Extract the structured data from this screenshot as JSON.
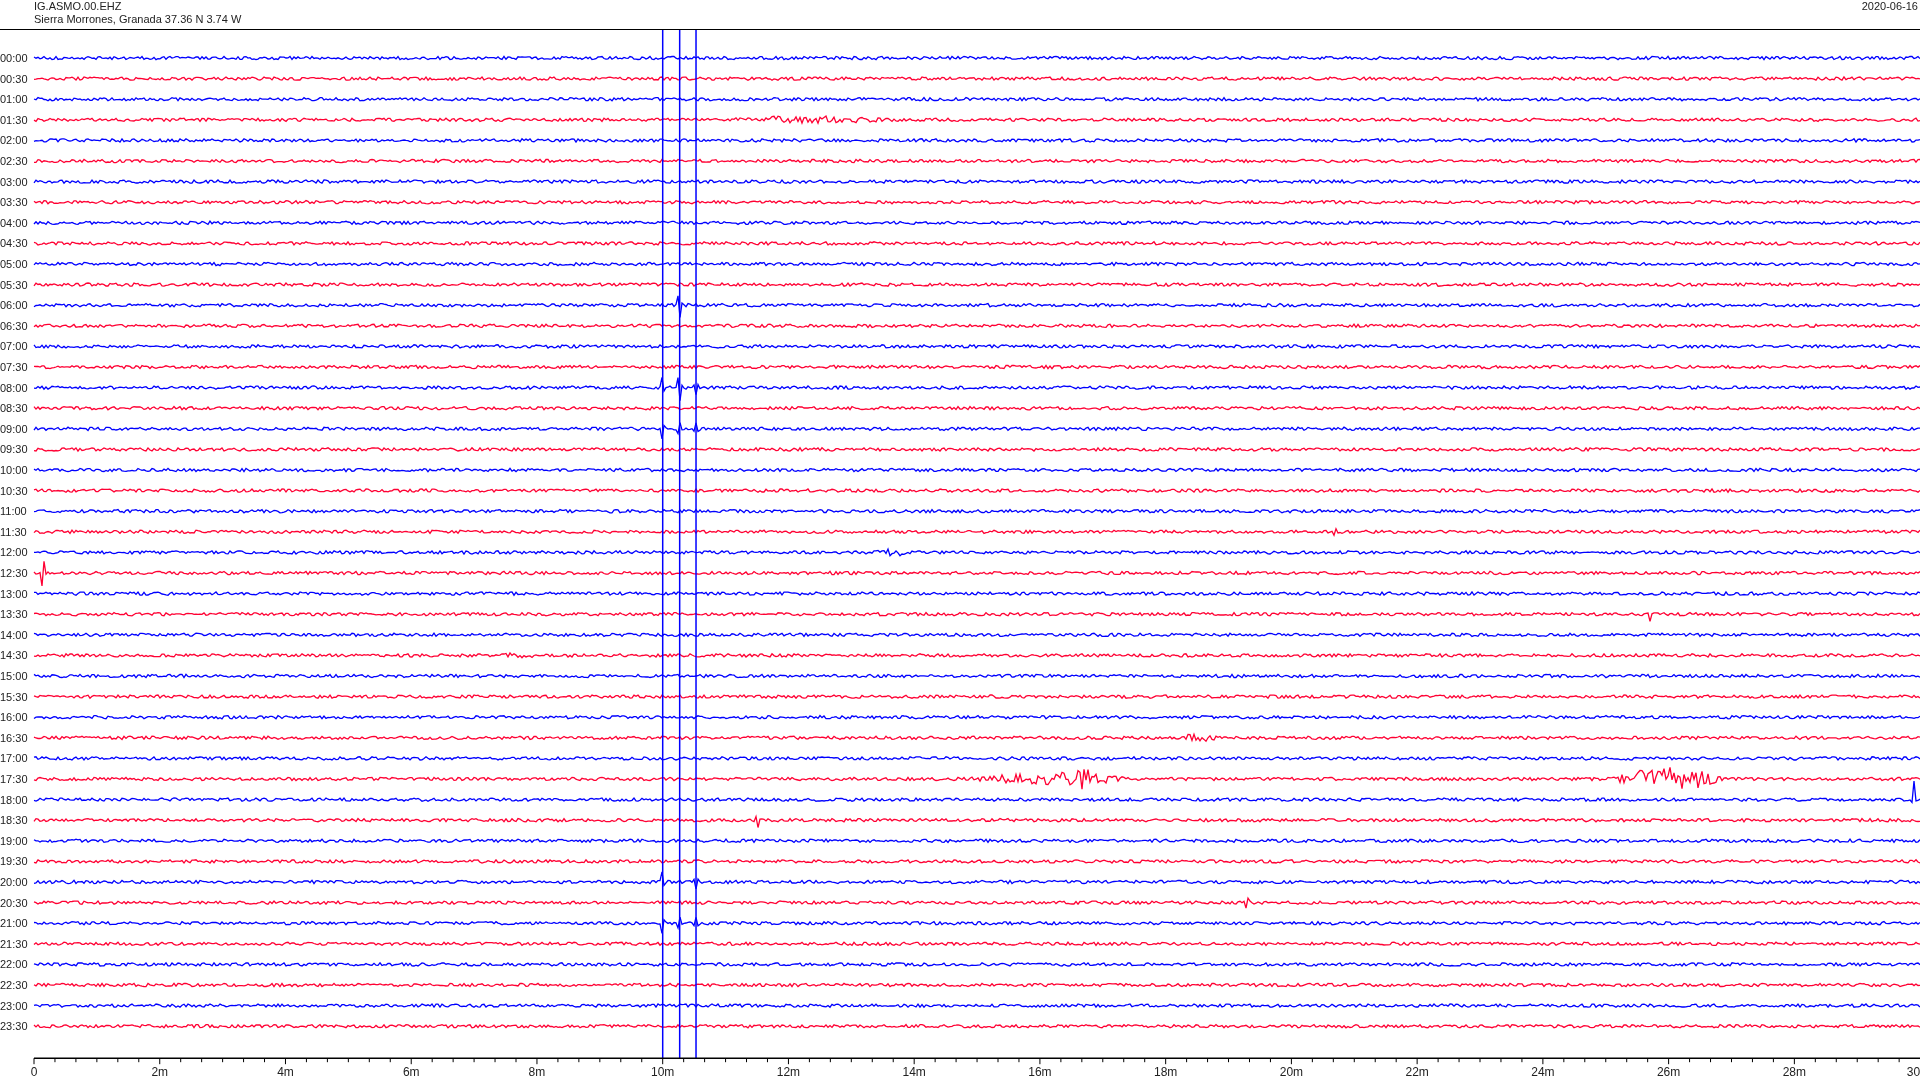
{
  "header": {
    "station": "IG.ASMO.00.EHZ",
    "location": "Sierra Morrones, Granada  37.36 N 3.74 W",
    "date": "2020-06-16"
  },
  "rows": [
    {
      "label": "00:00",
      "color": "#0000ff"
    },
    {
      "label": "00:30",
      "color": "#ff0033"
    },
    {
      "label": "01:00",
      "color": "#0000ff"
    },
    {
      "label": "01:30",
      "color": "#ff0033"
    },
    {
      "label": "02:00",
      "color": "#0000ff"
    },
    {
      "label": "02:30",
      "color": "#ff0033"
    },
    {
      "label": "03:00",
      "color": "#0000ff"
    },
    {
      "label": "03:30",
      "color": "#ff0033"
    },
    {
      "label": "04:00",
      "color": "#0000ff"
    },
    {
      "label": "04:30",
      "color": "#ff0033"
    },
    {
      "label": "05:00",
      "color": "#0000ff"
    },
    {
      "label": "05:30",
      "color": "#ff0033"
    },
    {
      "label": "06:00",
      "color": "#0000ff"
    },
    {
      "label": "06:30",
      "color": "#ff0033"
    },
    {
      "label": "07:00",
      "color": "#0000ff"
    },
    {
      "label": "07:30",
      "color": "#ff0033"
    },
    {
      "label": "08:00",
      "color": "#0000ff"
    },
    {
      "label": "08:30",
      "color": "#ff0033"
    },
    {
      "label": "09:00",
      "color": "#0000ff"
    },
    {
      "label": "09:30",
      "color": "#ff0033"
    },
    {
      "label": "10:00",
      "color": "#0000ff"
    },
    {
      "label": "10:30",
      "color": "#ff0033"
    },
    {
      "label": "11:00",
      "color": "#0000ff"
    },
    {
      "label": "11:30",
      "color": "#ff0033"
    },
    {
      "label": "12:00",
      "color": "#0000ff"
    },
    {
      "label": "12:30",
      "color": "#ff0033"
    },
    {
      "label": "13:00",
      "color": "#0000ff"
    },
    {
      "label": "13:30",
      "color": "#ff0033"
    },
    {
      "label": "14:00",
      "color": "#0000ff"
    },
    {
      "label": "14:30",
      "color": "#ff0033"
    },
    {
      "label": "15:00",
      "color": "#0000ff"
    },
    {
      "label": "15:30",
      "color": "#ff0033"
    },
    {
      "label": "16:00",
      "color": "#0000ff"
    },
    {
      "label": "16:30",
      "color": "#ff0033"
    },
    {
      "label": "17:00",
      "color": "#0000ff"
    },
    {
      "label": "17:30",
      "color": "#ff0033"
    },
    {
      "label": "18:00",
      "color": "#0000ff"
    },
    {
      "label": "18:30",
      "color": "#ff0033"
    },
    {
      "label": "19:00",
      "color": "#0000ff"
    },
    {
      "label": "19:30",
      "color": "#ff0033"
    },
    {
      "label": "20:00",
      "color": "#0000ff"
    },
    {
      "label": "20:30",
      "color": "#ff0033"
    },
    {
      "label": "21:00",
      "color": "#0000ff"
    },
    {
      "label": "21:30",
      "color": "#ff0033"
    },
    {
      "label": "22:00",
      "color": "#0000ff"
    },
    {
      "label": "22:30",
      "color": "#ff0033"
    },
    {
      "label": "23:00",
      "color": "#0000ff"
    },
    {
      "label": "23:30",
      "color": "#ff0033"
    }
  ],
  "x_axis": {
    "ticks": [
      "0",
      "2m",
      "4m",
      "6m",
      "8m",
      "10m",
      "12m",
      "14m",
      "16m",
      "18m",
      "20m",
      "22m",
      "24m",
      "26m",
      "28m",
      "30"
    ]
  }
}
